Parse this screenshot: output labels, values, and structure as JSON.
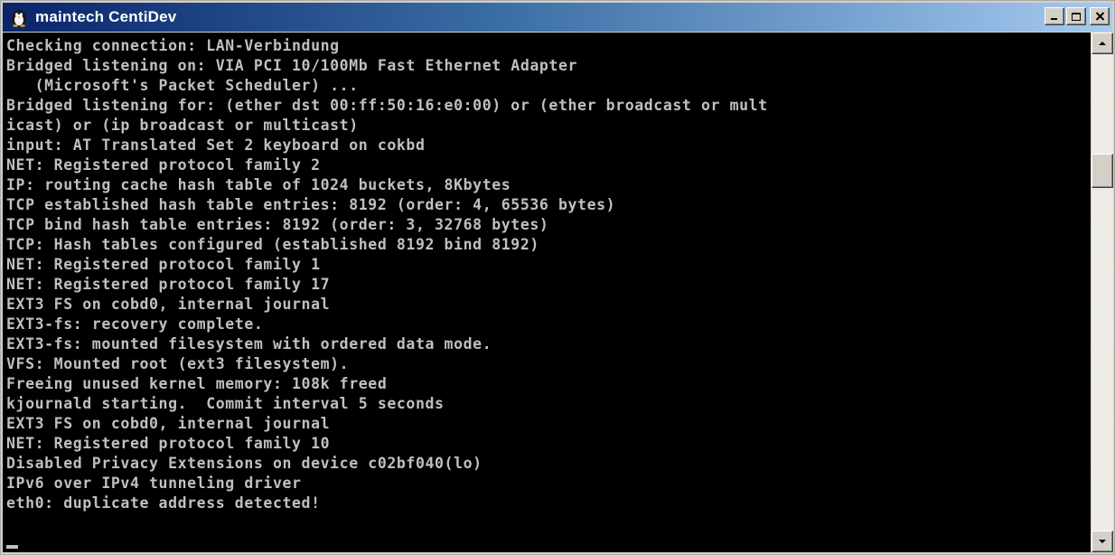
{
  "window": {
    "title": "maintech CentiDev",
    "icon": "app-icon",
    "buttons": [
      "minimize-icon",
      "maximize-icon",
      "close-icon"
    ]
  },
  "console": {
    "lines": [
      "Checking connection: LAN-Verbindung",
      "Bridged listening on: VIA PCI 10/100Mb Fast Ethernet Adapter",
      "   (Microsoft's Packet Scheduler) ...",
      "Bridged listening for: (ether dst 00:ff:50:16:e0:00) or (ether broadcast or mult",
      "icast) or (ip broadcast or multicast)",
      "input: AT Translated Set 2 keyboard on cokbd",
      "NET: Registered protocol family 2",
      "IP: routing cache hash table of 1024 buckets, 8Kbytes",
      "TCP established hash table entries: 8192 (order: 4, 65536 bytes)",
      "TCP bind hash table entries: 8192 (order: 3, 32768 bytes)",
      "TCP: Hash tables configured (established 8192 bind 8192)",
      "NET: Registered protocol family 1",
      "NET: Registered protocol family 17",
      "EXT3 FS on cobd0, internal journal",
      "EXT3-fs: recovery complete.",
      "EXT3-fs: mounted filesystem with ordered data mode.",
      "VFS: Mounted root (ext3 filesystem).",
      "Freeing unused kernel memory: 108k freed",
      "kjournald starting.  Commit interval 5 seconds",
      "EXT3 FS on cobd0, internal journal",
      "NET: Registered protocol family 10",
      "Disabled Privacy Extensions on device c02bf040(lo)",
      "IPv6 over IPv4 tunneling driver",
      "eth0: duplicate address detected!"
    ]
  },
  "scrollbar": {
    "up_icon": "scroll-up-arrow-icon",
    "down_icon": "scroll-down-arrow-icon"
  },
  "colors": {
    "console_bg": "#000000",
    "console_fg": "#c0c0c0",
    "title_active": "#0a246a"
  }
}
